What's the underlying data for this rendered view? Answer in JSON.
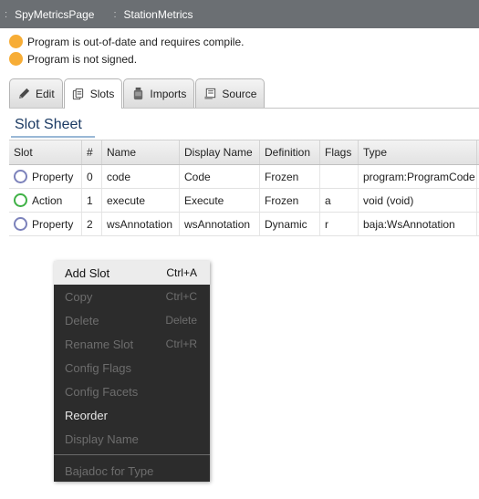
{
  "breadcrumb": [
    {
      "sep": ":",
      "label": "SpyMetricsPage"
    },
    {
      "sep": ":",
      "label": "StationMetrics"
    }
  ],
  "statuses": [
    {
      "text": "Program is out-of-date and requires compile.",
      "color": "#f7ad36"
    },
    {
      "text": "Program is not signed.",
      "color": "#f7ad36"
    }
  ],
  "tabs": [
    {
      "label": "Edit",
      "icon": "pencil-icon",
      "active": false
    },
    {
      "label": "Slots",
      "icon": "slots-icon",
      "active": true
    },
    {
      "label": "Imports",
      "icon": "jar-icon",
      "active": false
    },
    {
      "label": "Source",
      "icon": "scroll-icon",
      "active": false
    }
  ],
  "sheet_title": "Slot Sheet",
  "table": {
    "columns": [
      "Slot",
      "#",
      "Name",
      "Display Name",
      "Definition",
      "Flags",
      "Type"
    ],
    "rows": [
      {
        "slot": "Property",
        "num": "0",
        "name": "code",
        "display": "Code",
        "definition": "Frozen",
        "flags": "",
        "type": "program:ProgramCode",
        "kind": "property"
      },
      {
        "slot": "Action",
        "num": "1",
        "name": "execute",
        "display": "Execute",
        "definition": "Frozen",
        "flags": "a",
        "type": "void (void)",
        "kind": "action"
      },
      {
        "slot": "Property",
        "num": "2",
        "name": "wsAnnotation",
        "display": "wsAnnotation",
        "definition": "Dynamic",
        "flags": "r",
        "type": "baja:WsAnnotation",
        "kind": "property"
      }
    ]
  },
  "context_menu": {
    "items": [
      {
        "label": "Add Slot",
        "shortcut": "Ctrl+A",
        "enabled": true,
        "highlight": true
      },
      {
        "label": "Copy",
        "shortcut": "Ctrl+C",
        "enabled": false
      },
      {
        "label": "Delete",
        "shortcut": "Delete",
        "enabled": false
      },
      {
        "label": "Rename Slot",
        "shortcut": "Ctrl+R",
        "enabled": false
      },
      {
        "label": "Config Flags",
        "shortcut": "",
        "enabled": false
      },
      {
        "label": "Config Facets",
        "shortcut": "",
        "enabled": false
      },
      {
        "label": "Reorder",
        "shortcut": "",
        "enabled": true
      },
      {
        "label": "Display Name",
        "shortcut": "",
        "enabled": false
      }
    ],
    "after_separator": [
      {
        "label": "Bajadoc for Type",
        "shortcut": "",
        "enabled": false
      }
    ]
  },
  "colors": {
    "status_dot": "#f7ad36",
    "property_ring": "#7c82bb",
    "action_ring": "#3fb146",
    "menu_bg": "#2c2c2c"
  }
}
